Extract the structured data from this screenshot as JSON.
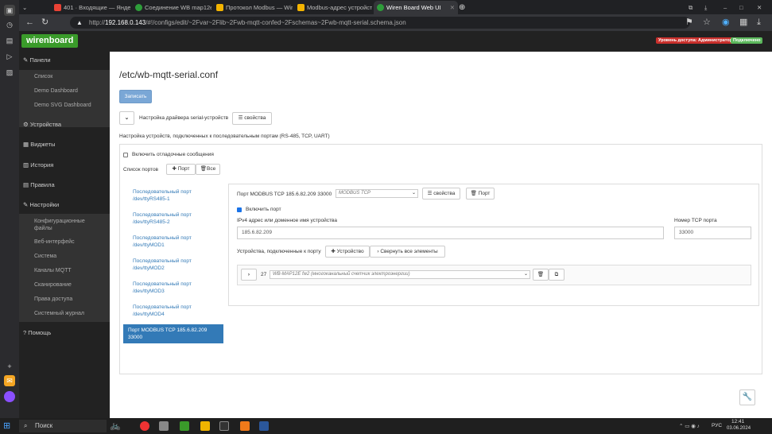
{
  "browser": {
    "tabs": [
      {
        "label": "401 · Входящие — Яндекс"
      },
      {
        "label": "Соединение WB map12e"
      },
      {
        "label": "Протокол Modbus — Wiren"
      },
      {
        "label": "Modbus-адрес устройств"
      },
      {
        "label": "Wiren Board Web UI"
      }
    ],
    "url_prefix": "http://",
    "url_host": "192.168.0.143",
    "url_path": "/#!/configs/edit/~2Fvar~2Flib~2Fwb-mqtt-confed~2Fschemas~2Fwb-mqtt-serial.schema.json"
  },
  "navbar": {
    "logo": "wirenboard",
    "access_label": "Уровень доступа: Администратор",
    "connected_label": "Подключено"
  },
  "sidebar": {
    "panels": "Панели",
    "panels_sub": [
      "Список",
      "Demo Dashboard",
      "Demo SVG Dashboard"
    ],
    "devices": "Устройства",
    "widgets": "Виджеты",
    "history": "История",
    "rules": "Правила",
    "settings": "Настройки",
    "settings_sub": [
      "Конфигурационные файлы",
      "Веб-интерфейс",
      "Система",
      "Каналы MQTT",
      "Сканирование",
      "Права доступа",
      "Системный журнал"
    ],
    "help": "Помощь"
  },
  "main": {
    "title": "/etc/wb-mqtt-serial.conf",
    "save_button": "Записать",
    "driver_settings": "Настройка драйвера serial-устройств",
    "properties": "свойства",
    "description": "Настройка устройств, подключенных к последовательным портам (RS-485, TCP, UART)",
    "debug_label": "Включить отладочные сообщения",
    "ports_list_label": "Список портов",
    "add_port": "Порт",
    "all": "Все",
    "ports": [
      {
        "line1": "Последовательный порт",
        "line2": "/dev/ttyRS485-1"
      },
      {
        "line1": "Последовательный порт",
        "line2": "/dev/ttyRS485-2"
      },
      {
        "line1": "Последовательный порт",
        "line2": "/dev/ttyMOD1"
      },
      {
        "line1": "Последовательный порт",
        "line2": "/dev/ttyMOD2"
      },
      {
        "line1": "Последовательный порт",
        "line2": "/dev/ttyMOD3"
      },
      {
        "line1": "Последовательный порт",
        "line2": "/dev/ttyMOD4"
      },
      {
        "line1": "Порт MODBUS TCP 185.6.82.209",
        "line2": "33000"
      }
    ],
    "port_detail": {
      "header": "Порт MODBUS TCP 185.6.82.209 33000",
      "type_select": "MODBUS TCP",
      "properties": "свойства",
      "port_button": "Порт",
      "enable_label": "Включить порт",
      "address_label": "IPv4 адрес или доменное имя устройства",
      "address_value": "185.6.82.209",
      "tcp_port_label": "Номер TCP порта",
      "tcp_port_value": "33000",
      "devices_label": "Устройства, подключенные к порту",
      "add_device": "Устройство",
      "collapse_all": "Свернуть все элементы",
      "device_index": "27",
      "device_select": "WB-MAP12E fw2 (многоканальный счетчик электроэнергии)"
    }
  },
  "taskbar": {
    "search": "Поиск",
    "lang": "РУС",
    "time": "12:41",
    "date": "03.06.2024"
  }
}
